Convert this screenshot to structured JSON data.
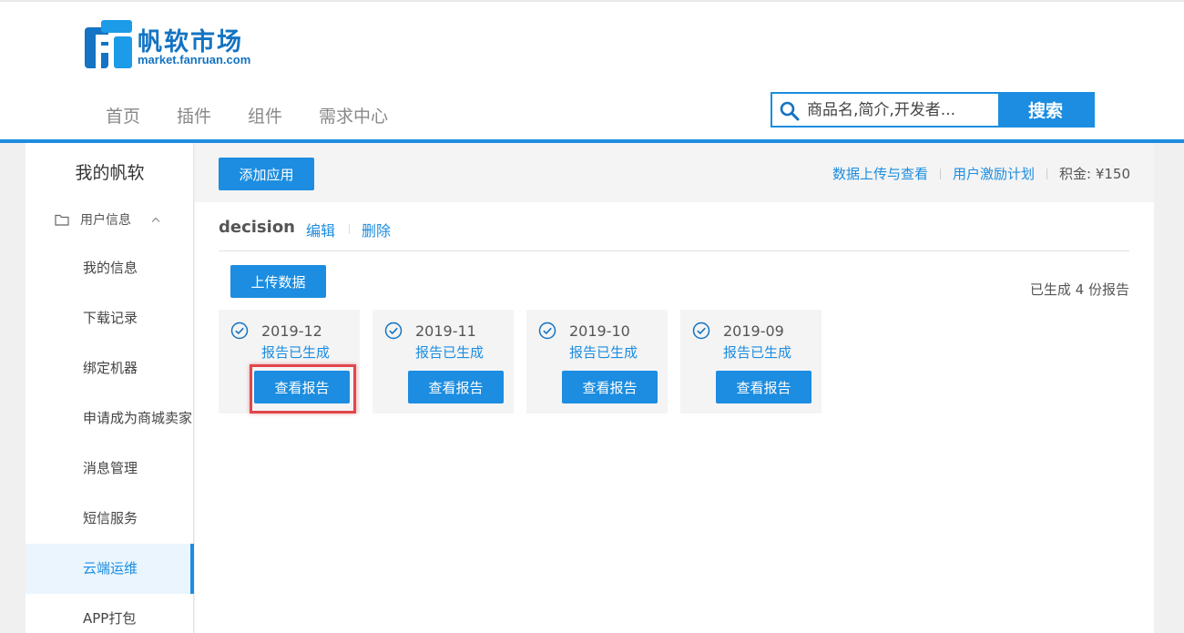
{
  "brand": {
    "title": "帆软市场",
    "subtitle": "market.fanruan.com",
    "color": "#1473c2"
  },
  "nav": {
    "items": [
      {
        "label": "首页"
      },
      {
        "label": "插件"
      },
      {
        "label": "组件"
      },
      {
        "label": "需求中心"
      }
    ]
  },
  "search": {
    "placeholder": "商品名,简介,开发者...",
    "button_label": "搜索"
  },
  "sidebar": {
    "title": "我的帆软",
    "group_label": "用户信息",
    "items": [
      {
        "label": "我的信息"
      },
      {
        "label": "下载记录"
      },
      {
        "label": "绑定机器"
      },
      {
        "label": "申请成为商城卖家"
      },
      {
        "label": "消息管理"
      },
      {
        "label": "短信服务"
      },
      {
        "label": "云端运维"
      },
      {
        "label": "APP打包"
      }
    ],
    "active_item": "云端运维"
  },
  "toolbar": {
    "add_app_label": "添加应用",
    "links": [
      "数据上传与查看",
      "用户激励计划"
    ],
    "points": "积金: ¥150"
  },
  "app": {
    "name": "decision",
    "edit_label": "编辑",
    "delete_label": "删除",
    "upload_label": "上传数据",
    "report_count": "已生成 4 份报告"
  },
  "reports": [
    {
      "date": "2019-12",
      "status": "报告已生成",
      "button_label": "查看报告"
    },
    {
      "date": "2019-11",
      "status": "报告已生成",
      "button_label": "查看报告"
    },
    {
      "date": "2019-10",
      "status": "报告已生成",
      "button_label": "查看报告"
    },
    {
      "date": "2019-09",
      "status": "报告已生成",
      "button_label": "查看报告"
    }
  ],
  "colors": {
    "accent": "#1c8de0",
    "highlight": "#e0474c"
  },
  "icons": {
    "logo": "fanruan-logo-icon",
    "search": "search-icon",
    "folder": "folder-icon",
    "collapse": "chevron-up-icon",
    "check": "check-circle-icon"
  }
}
